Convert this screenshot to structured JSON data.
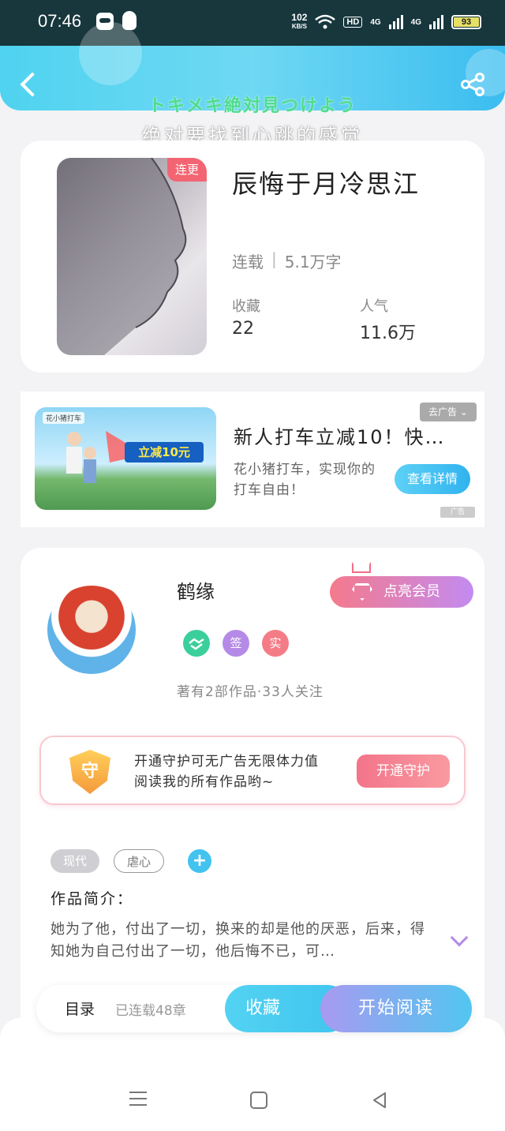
{
  "status_bar": {
    "time": "07:46",
    "net_speed": "102",
    "net_unit": "KB/S",
    "hd": "HD",
    "net1": "4G",
    "net2": "4G",
    "battery": "93"
  },
  "header": {
    "slogan_jp": "トキメキ絶対見つけよう",
    "slogan_cn": "绝对要找到心跳的感觉"
  },
  "book": {
    "cover_tag": "连更",
    "title": "辰悔于月冷思江",
    "status": "连载",
    "words": "5.1万字",
    "collect_label": "收藏",
    "collect_value": "22",
    "popularity_label": "人气",
    "popularity_value": "11.6万"
  },
  "ad": {
    "brand": "花小猪打车",
    "banner": "立减10元",
    "remove_label": "去广告",
    "title": "新人打车立减10！快…",
    "desc": "花小猪打车，实现你的打车自由！",
    "cta": "查看详情",
    "mark": "广告"
  },
  "author": {
    "name": "鹤缘",
    "vip_label": "点亮会员",
    "badges": [
      "签",
      "实"
    ],
    "stats": "著有2部作品·33人关注",
    "guard_icon": "守",
    "guard_text": "开通守护可无广告无限体力值阅读我的所有作品哟~",
    "guard_btn": "开通守护",
    "tags": [
      "现代",
      "虐心"
    ],
    "intro_label": "作品简介：",
    "intro_text": "她为了他，付出了一切，换来的却是他的厌恶，后来，得知她为自己付出了一切，他后悔不已，可…"
  },
  "bottom": {
    "toc_label": "目录",
    "toc_info": "已连载48章",
    "fav_label": "收藏",
    "read_label": "开始阅读"
  }
}
